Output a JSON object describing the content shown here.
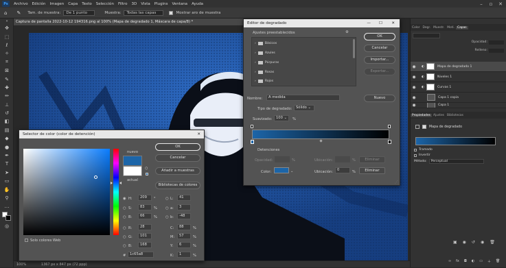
{
  "menubar": {
    "logo": "Ps",
    "items": [
      "Archivo",
      "Edición",
      "Imagen",
      "Capa",
      "Texto",
      "Selección",
      "Filtro",
      "3D",
      "Vista",
      "Plugins",
      "Ventana",
      "Ayuda"
    ]
  },
  "optionsbar": {
    "size_label": "Tam. de muestra:",
    "size_value": "De 1 punto",
    "sample_label": "Muestra:",
    "sample_value": "Todas las capas",
    "ring_label": "Mostrar aro de muestra"
  },
  "document": {
    "tab": "Captura de pantalla 2022-10-12 194316.png al 100% (Mapa de degradado 1, Máscara de capa/8) *"
  },
  "status": {
    "zoom": "100%",
    "info": "1367 px x 847 px (72 ppp)"
  },
  "gradient_editor": {
    "title": "Editor de degradado",
    "presets_label": "Ajustes preestablecidos",
    "folders": [
      "Básicos",
      "Azules",
      "Púrpuras",
      "Rosas",
      "Rojos"
    ],
    "ok": "OK",
    "cancel": "Cancelar",
    "import": "Importar...",
    "export": "Exportar...",
    "new": "Nuevo",
    "name_label": "Nombre:",
    "name_value": "A medida",
    "type_label": "Tipo de degradado:",
    "type_value": "Sólido",
    "smooth_label": "Suavizado:",
    "smooth_value": "100",
    "smooth_unit": "%",
    "stops_label": "Detenciones",
    "opacity_label": "Opacidad:",
    "opacity_unit": "%",
    "location_label": "Ubicación:",
    "location_unit": "%",
    "delete_label": "Eliminar",
    "color_label": "Color:",
    "color_location_value": "0",
    "color_location_unit": "%",
    "color_delete": "Eliminar"
  },
  "color_picker": {
    "title": "Selector de color (color de detención)",
    "ok": "OK",
    "cancel": "Cancelar",
    "add_swatches": "Añadir a muestras",
    "libraries": "Bibliotecas de colores",
    "new_label": "nuevo",
    "current_label": "actual",
    "web_only": "Solo colores Web",
    "fields": {
      "H": "209",
      "S": "83",
      "B": "66",
      "R": "28",
      "G": "101",
      "Bv": "168",
      "L": "41",
      "a": "3",
      "b": "-48",
      "C": "88",
      "M": "57",
      "Y": "6",
      "K": "1",
      "hex": "1c65a8"
    },
    "units": {
      "deg": "°",
      "pct": "%"
    },
    "new_color": "#1c65a8",
    "current_color": "#ffffff"
  },
  "right_panel": {
    "tabs": [
      "Color",
      "Degr.",
      "Muestr.",
      "Moti.",
      "Capas"
    ],
    "tabs2": [
      "Propiedades",
      "Ajustes",
      "Bibliotecas"
    ],
    "layer_items": [
      "Mapa de degradado 1",
      "Niveles 1",
      "Curvas 1",
      "Capa 1 copia",
      "Capa 1"
    ],
    "props_title": "Mapa de degradado",
    "dither": "Tramado",
    "reverse": "Invertir",
    "method_label": "Método:",
    "method_value": "Perceptual",
    "layer_opacity": "Opacidad:",
    "layer_fill": "Relleno:"
  }
}
